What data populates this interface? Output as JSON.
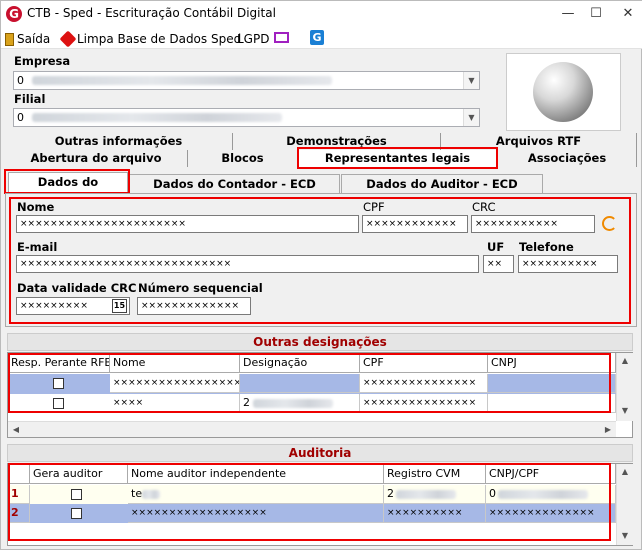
{
  "window": {
    "title": "CTB - Sped - Escrituração Contábil Digital",
    "app_icon_letter": "G",
    "controls": {
      "minimize": "—",
      "maximize": "☐",
      "close": "✕"
    }
  },
  "menu": {
    "saida": "Saída",
    "limpar": "Limpa Base de Dados Sped",
    "lgpd": "LGPD"
  },
  "header": {
    "empresa_label": "Empresa",
    "empresa_value": "0",
    "filial_label": "Filial",
    "filial_value": "0"
  },
  "tabs_row1": [
    "Outras informações",
    "Demonstrações",
    "Arquivos RTF"
  ],
  "tabs_row2": [
    "Abertura do arquivo",
    "Blocos",
    "Representantes legais",
    "Associações"
  ],
  "subtabs": [
    "Dados do Contador",
    "Dados do Contador - ECD Substituta",
    "Dados do Auditor - ECD Substituta"
  ],
  "contador": {
    "nome_label": "Nome",
    "nome_value": "××××××××××××××××××××××",
    "cpf_label": "CPF",
    "cpf_value": "××××××××××××",
    "crc_label": "CRC",
    "crc_value": "×××××××××××",
    "email_label": "E-mail",
    "email_value": "××××××××××××××××××××××××××××",
    "uf_label": "UF",
    "uf_value": "××",
    "telefone_label": "Telefone",
    "telefone_value": "××××××××××",
    "data_crc_label": "Data validade CRC",
    "data_crc_value": "×××××××××",
    "cal_icon": "15",
    "numseq_label": "Número sequencial",
    "numseq_value": "×××××××××××××"
  },
  "outras": {
    "title": "Outras designações",
    "columns": [
      "Resp. Perante RFB",
      "Nome",
      "Designação",
      "CPF",
      "CNPJ"
    ],
    "rows": [
      {
        "nome": "××××××××××××××××××××××",
        "designacao": "",
        "cpf": "×××××××××××××××",
        "cnpj": ""
      },
      {
        "nome": "××××",
        "designacao": "2",
        "cpf": "×××××××××××××××",
        "cnpj": ""
      }
    ]
  },
  "auditoria": {
    "title": "Auditoria",
    "columns": [
      "Gera auditor",
      "Nome auditor independente",
      "Registro CVM",
      "CNPJ/CPF"
    ],
    "rows": [
      {
        "num": "1",
        "nome": "te",
        "registro": "2",
        "cnpj": "0"
      },
      {
        "num": "2",
        "nome": "××××××××××××××××××",
        "registro": "××××××××××",
        "cnpj": "××××××××××××××"
      }
    ]
  },
  "colors": {
    "brand_red": "#c8102e",
    "section_title": "#a00000",
    "highlight_row": "#a6b8e6",
    "annotation_red": "#e00000"
  },
  "icons": [
    "app-logo-icon",
    "exit-door-icon",
    "clear-database-icon",
    "monitor-icon",
    "g-app-icon",
    "refresh-icon",
    "calendar-icon",
    "sphere-logo-icon"
  ]
}
